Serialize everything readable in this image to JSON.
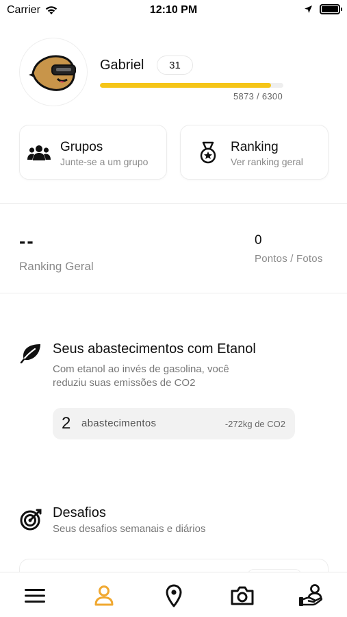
{
  "status_bar": {
    "carrier": "Carrier",
    "time": "12:10 PM"
  },
  "profile": {
    "name": "Gabriel",
    "level": "31",
    "xp_text": "5873 / 6300",
    "xp_progress": 0.932
  },
  "cards": {
    "groups": {
      "title": "Grupos",
      "subtitle": "Junte-se a um grupo",
      "icon": "users-icon"
    },
    "ranking": {
      "title": "Ranking",
      "subtitle": "Ver ranking geral",
      "icon": "medal-icon"
    }
  },
  "stats": {
    "ranking_value": "--",
    "ranking_label": "Ranking Geral",
    "points_value": "0",
    "points_label": "Pontos / Fotos"
  },
  "ethanol": {
    "title": "Seus abastecimentos com Etanol",
    "subtitle_line1": "Com etanol ao invés de gasolina, você",
    "subtitle_line2": "reduziu suas emissões de CO2",
    "count": "2",
    "count_label": "abastecimentos",
    "co2": "-272kg de CO2",
    "icon": "leaf-icon"
  },
  "challenges": {
    "title": "Desafios",
    "subtitle": "Seus desafios semanais e diários",
    "icon": "target-icon"
  },
  "tabbar": {
    "items": [
      "menu-icon",
      "profile-icon",
      "map-pin-icon",
      "camera-icon",
      "hand-user-icon"
    ],
    "active": "profile-icon",
    "active_color": "#f0a830"
  },
  "colors": {
    "accent": "#f5c518"
  }
}
